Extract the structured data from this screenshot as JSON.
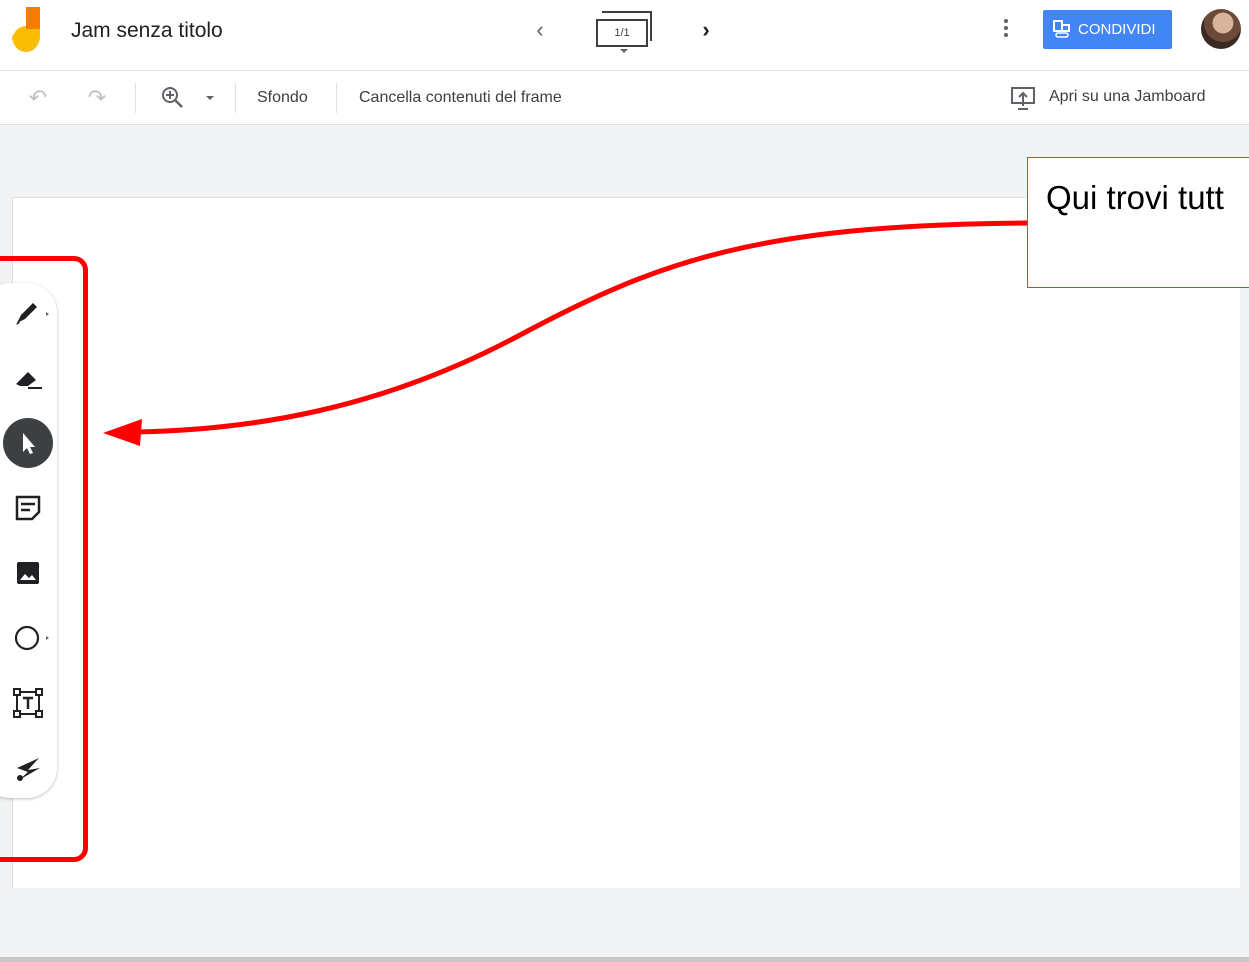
{
  "app": {
    "document_title": "Jam senza titolo",
    "frame_indicator": "1/1",
    "share_label": "CONDIVIDI",
    "brand_colors": {
      "primary": "#4285f4",
      "logo_orange": "#f57c00",
      "logo_yellow": "#fbbc04"
    }
  },
  "toolbar": {
    "background_label": "Sfondo",
    "clear_frame_label": "Cancella contenuti del frame",
    "open_on_jamboard_label": "Apri su una Jamboard"
  },
  "tools": [
    {
      "name": "pen",
      "icon": "pen-icon",
      "has_submenu": true
    },
    {
      "name": "eraser",
      "icon": "eraser-icon",
      "has_submenu": false
    },
    {
      "name": "select",
      "icon": "cursor-icon",
      "selected": true
    },
    {
      "name": "sticky-note",
      "icon": "sticky-note-icon",
      "has_submenu": false
    },
    {
      "name": "image",
      "icon": "image-icon",
      "has_submenu": false
    },
    {
      "name": "shape",
      "icon": "circle-icon",
      "has_submenu": true
    },
    {
      "name": "text-box",
      "icon": "text-box-icon",
      "has_submenu": false
    },
    {
      "name": "laser",
      "icon": "laser-icon",
      "has_submenu": false
    }
  ],
  "annotation": {
    "callout_text": "Qui trovi tutt",
    "highlight_color": "#ff0000"
  }
}
